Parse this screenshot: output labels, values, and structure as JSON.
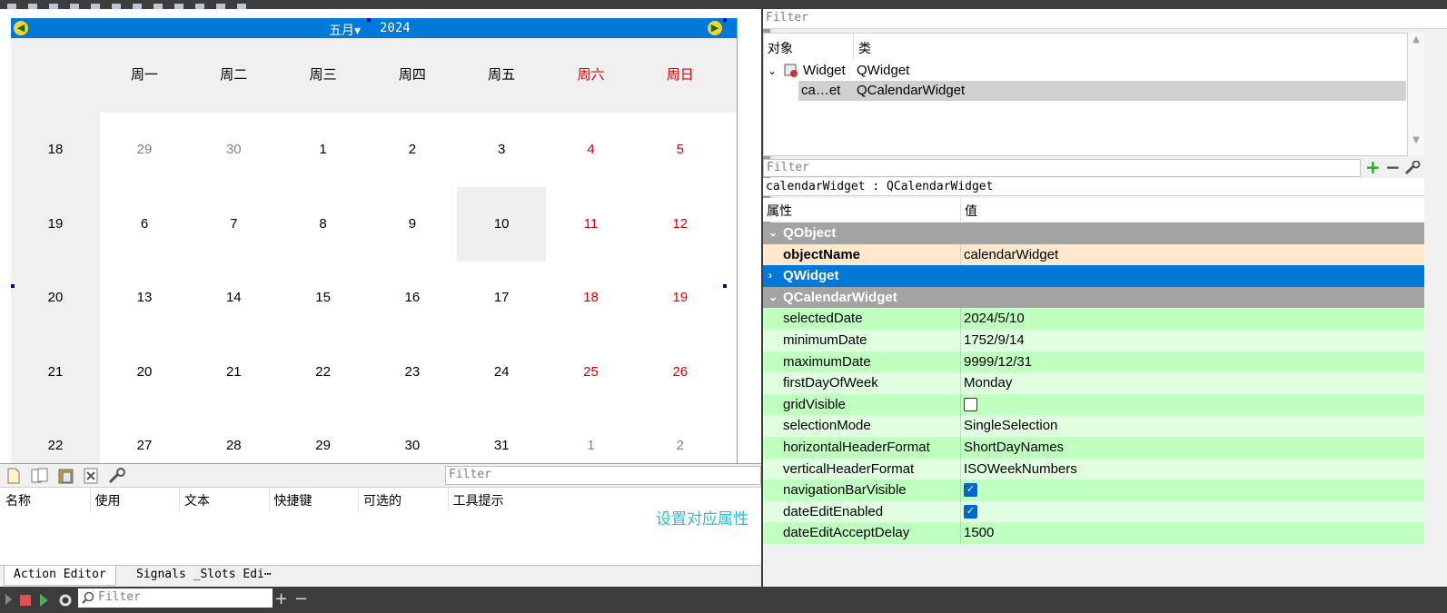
{
  "calendar": {
    "month": "五月",
    "year": "2024",
    "weekdays": [
      "周一",
      "周二",
      "周三",
      "周四",
      "周五",
      "周六",
      "周日"
    ],
    "weeks": [
      {
        "week": "18",
        "days": [
          "29",
          "30",
          "1",
          "2",
          "3",
          "4",
          "5"
        ]
      },
      {
        "week": "19",
        "days": [
          "6",
          "7",
          "8",
          "9",
          "10",
          "11",
          "12"
        ]
      },
      {
        "week": "20",
        "days": [
          "13",
          "14",
          "15",
          "16",
          "17",
          "18",
          "19"
        ]
      },
      {
        "week": "21",
        "days": [
          "20",
          "21",
          "22",
          "23",
          "24",
          "25",
          "26"
        ]
      },
      {
        "week": "22",
        "days": [
          "27",
          "28",
          "29",
          "30",
          "31",
          "1",
          "2"
        ]
      }
    ],
    "selected_day": "10"
  },
  "action_editor": {
    "filter_placeholder": "Filter",
    "columns": [
      "名称",
      "使用",
      "文本",
      "快捷键",
      "可选的",
      "工具提示"
    ],
    "annotation": "设置对应属性",
    "tabs": [
      "Action Editor",
      "Signals _Slots Edi⋯"
    ]
  },
  "statusbar": {
    "filter_placeholder": "Filter"
  },
  "object_inspector": {
    "filter_placeholder": "Filter",
    "columns": [
      "对象",
      "类"
    ],
    "rows": [
      {
        "object": "Widget",
        "class": "QWidget"
      },
      {
        "object": "ca…et",
        "class": "QCalendarWidget"
      }
    ]
  },
  "property_editor": {
    "filter_placeholder": "Filter",
    "title": "calendarWidget : QCalendarWidget",
    "columns": [
      "属性",
      "值"
    ],
    "groups": {
      "qobject": "QObject",
      "qwidget": "QWidget",
      "qcalendar": "QCalendarWidget"
    },
    "object_name": {
      "key": "objectName",
      "value": "calendarWidget"
    },
    "props": [
      {
        "key": "selectedDate",
        "value": "2024/5/10"
      },
      {
        "key": "minimumDate",
        "value": "1752/9/14"
      },
      {
        "key": "maximumDate",
        "value": "9999/12/31"
      },
      {
        "key": "firstDayOfWeek",
        "value": "Monday"
      },
      {
        "key": "gridVisible",
        "value": ""
      },
      {
        "key": "selectionMode",
        "value": "SingleSelection"
      },
      {
        "key": "horizontalHeaderFormat",
        "value": "ShortDayNames"
      },
      {
        "key": "verticalHeaderFormat",
        "value": "ISOWeekNumbers"
      },
      {
        "key": "navigationBarVisible",
        "value": ""
      },
      {
        "key": "dateEditEnabled",
        "value": ""
      },
      {
        "key": "dateEditAcceptDelay",
        "value": "1500"
      }
    ],
    "checkboxes": {
      "gridVisible": false,
      "navigationBarVisible": true,
      "dateEditEnabled": true
    },
    "accent": "#0078d7"
  }
}
